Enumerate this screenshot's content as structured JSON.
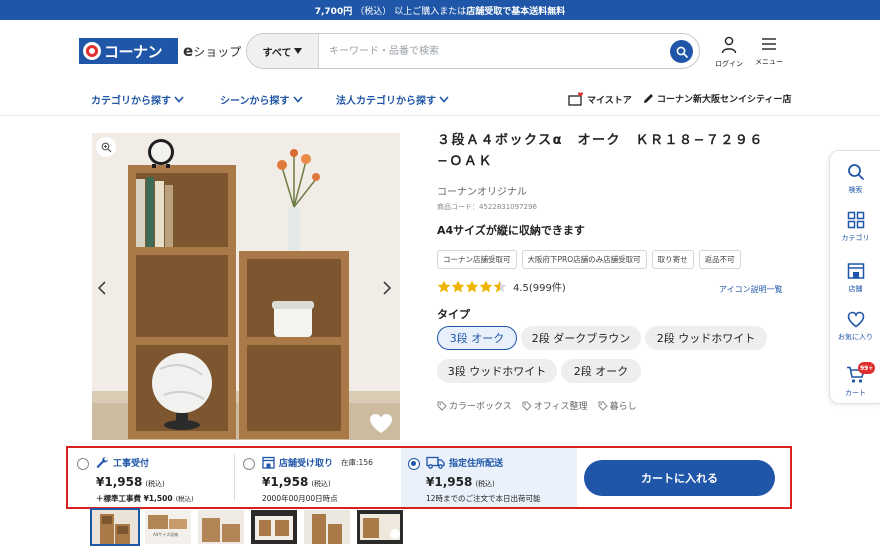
{
  "banner": {
    "price": "7,700円",
    "tax": "（税込）",
    "text_mid": "以上ご購入または",
    "highlight": "店舗受取",
    "text_end": "で基本送料無料"
  },
  "header": {
    "logo_text": "コーナン",
    "eshop_e": "e",
    "eshop_text": "ショップ",
    "search_category": "すべて",
    "search_placeholder": "キーワード・品番で検索",
    "login_label": "ログイン",
    "menu_label": "メニュー"
  },
  "nav": {
    "items": [
      "カテゴリから探す",
      "シーンから探す",
      "法人カテゴリから探す"
    ],
    "my_store": "マイストア",
    "store_name": "コーナン新大阪センイシティー店"
  },
  "product": {
    "title": "３段Ａ４ボックスα　オーク　ＫＲ１８−７２９６−ＯＡＫ",
    "brand": "コーナンオリジナル",
    "code": "商品コード：4522831097296",
    "catch": "A4サイズが縦に収納できます",
    "tags": [
      "コーナン店舗受取可",
      "大阪府下PRO店舗のみ店舗受取可",
      "取り寄せ",
      "返品不可"
    ],
    "rating": 4.5,
    "rating_text": "4.5(999件)",
    "icon_link": "アイコン説明一覧",
    "type_label": "タイプ",
    "types": [
      "3段 オーク",
      "2段 ダークブラウン",
      "2段 ウッドホワイト",
      "3段 ウッドホワイト",
      "2段 オーク"
    ],
    "selected_type": 0,
    "keywords": [
      "カラーボックス",
      "オフィス整理",
      "暮らし"
    ]
  },
  "sidebar": {
    "items": [
      "検索",
      "カテゴリ",
      "店舗",
      "お気に入り",
      "カート"
    ],
    "cart_badge": "99+"
  },
  "buybar": {
    "options": [
      {
        "label": "工事受付",
        "price": "¥1,958",
        "tax": "(税込)",
        "sub": "＋標準工事費 ¥1,500",
        "sub_tax": "(税込)",
        "selected": false
      },
      {
        "label": "店舗受け取り",
        "stock": "在庫:156",
        "price": "¥1,958",
        "tax": "(税込)",
        "sub": "2000年00月00日時点",
        "selected": false
      },
      {
        "label": "指定住所配送",
        "price": "¥1,958",
        "tax": "(税込)",
        "sub": "12時までのご注文で本日出荷可能",
        "selected": true
      }
    ],
    "cart_button": "カートに入れる"
  },
  "thumbs": {
    "count": 6,
    "thumb2_text": "A4サイズ収納"
  },
  "colors": {
    "brand_blue": "#1f56a8",
    "highlight_red": "#d8201e",
    "star_gold": "#f0b400"
  }
}
